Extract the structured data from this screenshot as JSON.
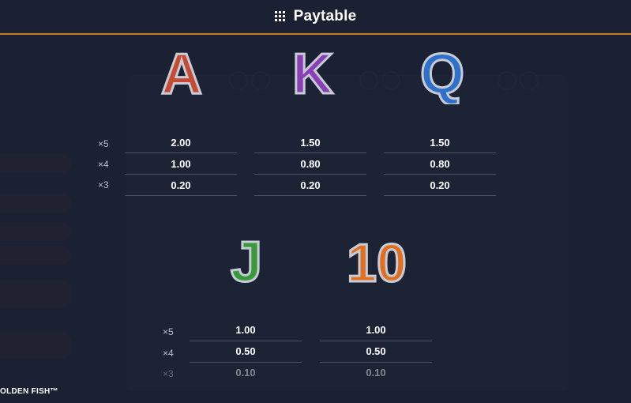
{
  "header": {
    "title": "Paytable",
    "menu_icon": "grid-menu-icon"
  },
  "paytable": {
    "group1": {
      "symbols": [
        {
          "letter": "A",
          "color": "#c94a33",
          "values": [
            "2.00",
            "1.00",
            "0.20"
          ]
        },
        {
          "letter": "K",
          "color": "#8a3fb5",
          "values": [
            "1.50",
            "0.80",
            "0.20"
          ]
        },
        {
          "letter": "Q",
          "color": "#2f70c9",
          "values": [
            "1.50",
            "0.80",
            "0.20"
          ]
        }
      ],
      "multipliers": [
        "×5",
        "×4",
        "×3"
      ]
    },
    "group2": {
      "symbols": [
        {
          "letter": "J",
          "color": "#3a9a3a",
          "values": [
            "1.00",
            "0.50",
            "0.10"
          ]
        },
        {
          "letter": "10",
          "color": "#e07020",
          "values": [
            "1.00",
            "0.50",
            "0.10"
          ]
        }
      ],
      "multipliers": [
        "×5",
        "×4",
        "×3"
      ]
    }
  },
  "footer": {
    "game_name": "OLDEN FISH™"
  }
}
